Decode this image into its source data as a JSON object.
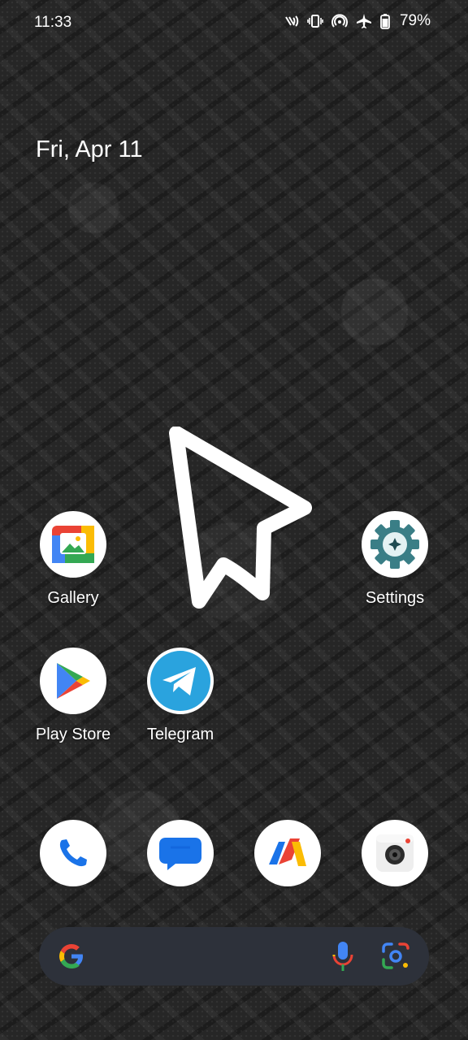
{
  "status_bar": {
    "time": "11:33",
    "battery_percent": "79%",
    "icons": [
      "nfc-icon",
      "vibrate-icon",
      "hotspot-icon",
      "airplane-icon",
      "battery-icon"
    ]
  },
  "date": "Fri, Apr 11",
  "apps": {
    "gallery": "Gallery",
    "settings": "Settings",
    "play_store": "Play Store",
    "telegram": "Telegram"
  },
  "dock": [
    "phone-icon",
    "messages-icon",
    "vlc-like-icon",
    "camera-icon"
  ],
  "search_bar": {
    "icons": [
      "google-g-icon",
      "mic-icon",
      "lens-icon"
    ]
  },
  "colors": {
    "wallpaper": "#262626",
    "search_bar": "#2d313a",
    "settings_teal": "#3a7e86",
    "telegram_blue": "#2aa3de"
  }
}
